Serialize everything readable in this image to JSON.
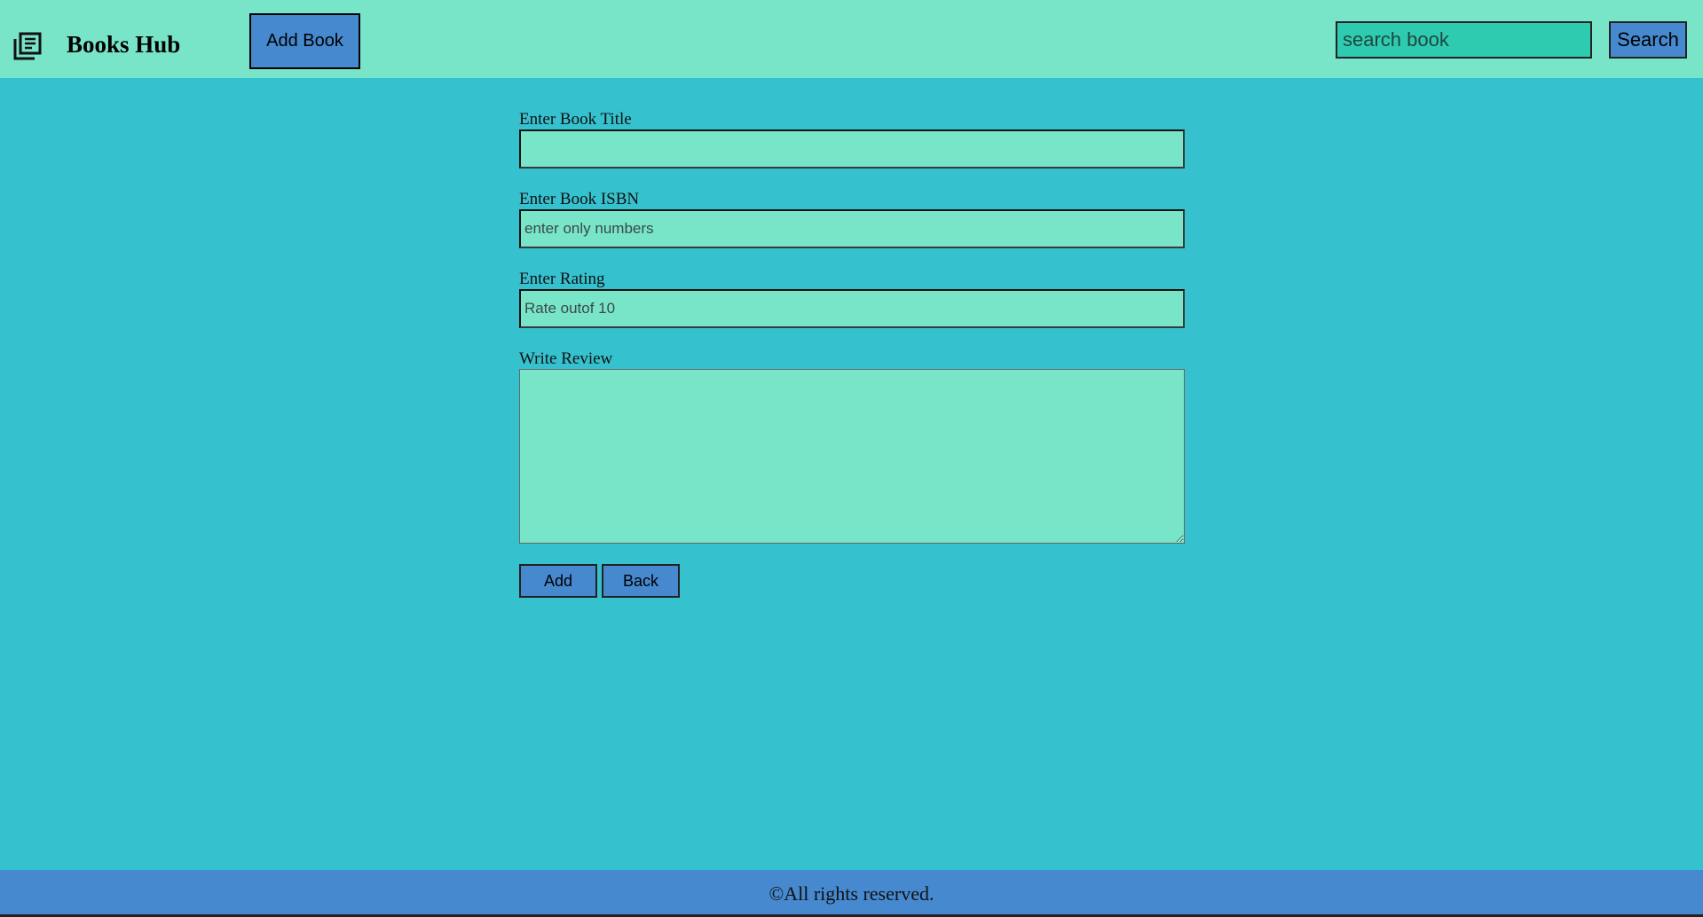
{
  "header": {
    "brand": "Books Hub",
    "add_book_label": "Add Book",
    "search_placeholder": "search book",
    "search_label": "Search",
    "logo_icon": "book-list-icon"
  },
  "form": {
    "title_label": "Enter Book Title",
    "title_value": "",
    "isbn_label": "Enter Book ISBN",
    "isbn_placeholder": "enter only numbers",
    "rating_label": "Enter Rating",
    "rating_placeholder": "Rate outof 10",
    "review_label": "Write Review",
    "review_value": "",
    "add_label": "Add",
    "back_label": "Back"
  },
  "footer": {
    "text": "©All rights reserved."
  },
  "colors": {
    "background": "#36c1cf",
    "navbar": "#78e5c9",
    "button": "#4689cf",
    "search_field": "#2ecbb1",
    "input_field": "#78e5c9",
    "footer": "#4689cf"
  }
}
